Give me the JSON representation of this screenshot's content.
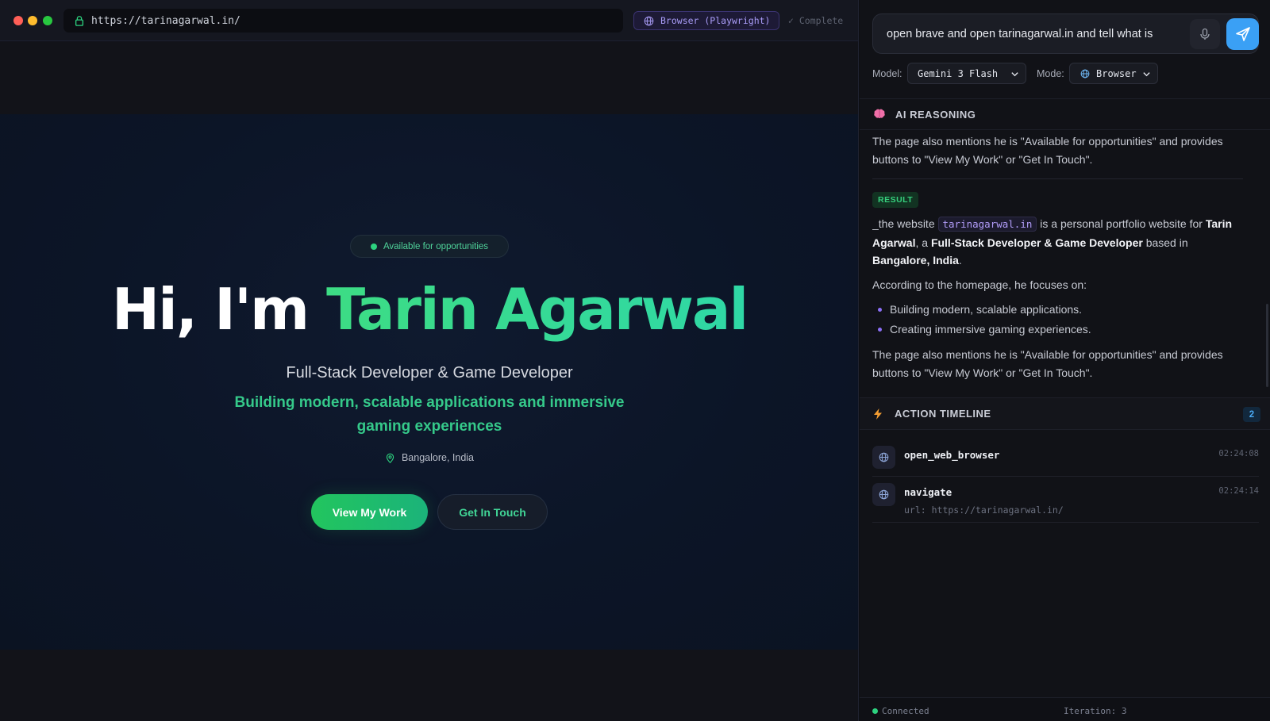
{
  "browser": {
    "url": "https://tarinagarwal.in/",
    "engine_badge": "Browser (Playwright)",
    "status": "✓ Complete",
    "colors": {
      "close": "#ff5f57",
      "minimize": "#febc2e",
      "maximize": "#28c840"
    }
  },
  "site": {
    "availability": "Available for opportunities",
    "greeting": "Hi, I'm",
    "name": "Tarin Agarwal",
    "subtitle": "Full-Stack Developer & Game Developer",
    "tagline": "Building modern, scalable applications and immersive gaming experiences",
    "location": "Bangalore, India",
    "primary_button": "View My Work",
    "secondary_button": "Get In Touch",
    "accent_color": "#3ddc84"
  },
  "agent": {
    "prompt_value": "open brave and open tarinagarwal.in and tell what is",
    "controls": {
      "model_label": "Model:",
      "model_value": "Gemini 3 Flash",
      "mode_label": "Mode:",
      "mode_value": "Browser"
    },
    "reasoning": {
      "title": "AI REASONING",
      "previous_text": "The page also mentions he is \"Available for opportunities\" and provides buttons to \"View My Work\" or \"Get In Touch\".",
      "result_badge": "RESULT",
      "result": {
        "p1": "_the website",
        "code": "tarinagarwal.in",
        "p2": " is a personal portfolio website for ",
        "b1": "Tarin Agarwal",
        "p3": ", a ",
        "b2": "Full-Stack Developer & Game Developer",
        "p4": " based in ",
        "b3": "Bangalore, India",
        "p5": "."
      },
      "focus_intro": "According to the homepage, he focuses on:",
      "focus_items": [
        "Building modern, scalable applications.",
        "Creating immersive gaming experiences."
      ],
      "final_text": "The page also mentions he is \"Available for opportunities\" and provides buttons to \"View My Work\" or \"Get In Touch\"."
    },
    "timeline": {
      "title": "ACTION TIMELINE",
      "count": "2",
      "items": [
        {
          "name": "open_web_browser",
          "time": "02:24:08",
          "detail": "",
          "icon": "globe-icon"
        },
        {
          "name": "navigate",
          "time": "02:24:14",
          "detail": "url: https://tarinagarwal.in/",
          "icon": "globe-icon"
        }
      ]
    },
    "status": {
      "connection": "Connected",
      "iteration": "Iteration: 3"
    },
    "colors": {
      "send_button": "#3aa0f5",
      "result_badge": "#36d07d",
      "bullet": "#8b6ff6"
    }
  }
}
